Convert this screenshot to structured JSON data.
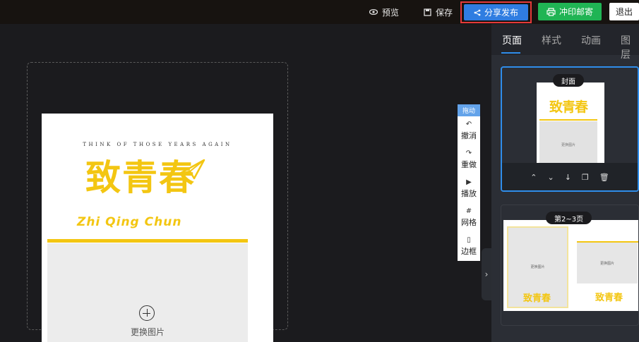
{
  "topbar": {
    "preview_label": "预览",
    "save_label": "保存",
    "share_label": "分享发布",
    "print_label": "冲印邮寄",
    "exit_label": "退出"
  },
  "canvas": {
    "tagline": "THINK OF THOSE YEARS AGAIN",
    "title_cn": "致青春",
    "title_en": "Zhi Qing Chun",
    "replace_image_label": "更换图片"
  },
  "vertical_toolbar": {
    "drag_label": "拖动",
    "undo_label": "撤消",
    "redo_label": "重做",
    "play_label": "播放",
    "grid_label": "网格",
    "border_label": "边框"
  },
  "right_panel": {
    "tabs": [
      {
        "label": "页面",
        "active": true
      },
      {
        "label": "样式",
        "active": false
      },
      {
        "label": "动画",
        "active": false
      },
      {
        "label": "图层",
        "active": false
      }
    ],
    "cards": [
      {
        "label": "封面"
      },
      {
        "label": "第2~3页"
      }
    ]
  },
  "colors": {
    "accent_blue": "#2f7de1",
    "print_green": "#20b454",
    "highlight_red": "#e43a3a",
    "title_yellow": "#f3c612"
  }
}
